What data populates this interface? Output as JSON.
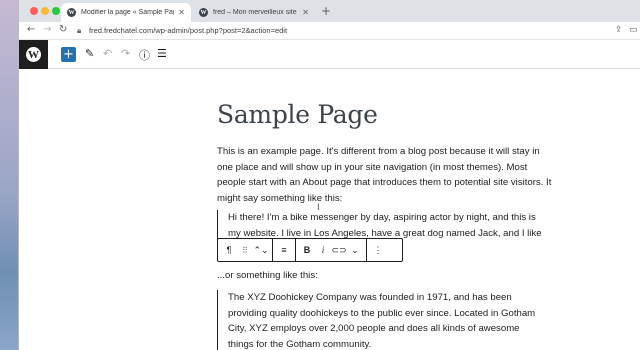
{
  "browser": {
    "tabs": [
      {
        "favicon": "W",
        "title": "Modifier la page « Sample Pag",
        "close": "✕",
        "active": true
      },
      {
        "favicon": "W",
        "title": "fred – Mon merveilleux site Wo",
        "close": "✕",
        "active": false
      }
    ],
    "new_tab": "+",
    "url": "fred.fredchatel.com/wp-admin/post.php?post=2&action=edit"
  },
  "editor": {
    "logo": "W",
    "inserter": "+",
    "icons": [
      "pencil-icon",
      "undo-icon",
      "redo-icon",
      "info-icon",
      "list-view-icon"
    ]
  },
  "content": {
    "title": "Sample Page",
    "intro": "This is an example page. It's different from a blog post because it will stay in one place and will show up in your site navigation (in most themes). Most people start with an About page that introduces them to potential site visitors. It might say something like this:",
    "quote1": "Hi there! I'm a bike messenger by day, aspiring actor by night, and this is my website. I live in Los Angeles, have a great dog named Jack, and I like piña coladas. (And gettin' caught in the rain.)",
    "or_text": "...or something like this:",
    "quote2": "The XYZ Doohickey Company was founded in 1971, and has been providing quality doohickeys to the public ever since. Located in Gotham City, XYZ employs over 2,000 people and does all kinds of awesome things for the Gotham community."
  },
  "block_toolbar": {
    "paragraph": "¶",
    "drag": "⠿",
    "move": "⌃⌄",
    "align": "≡",
    "bold": "B",
    "italic": "i",
    "link": "⊂⊃",
    "more_rich": "⌄",
    "options": "⋮"
  }
}
